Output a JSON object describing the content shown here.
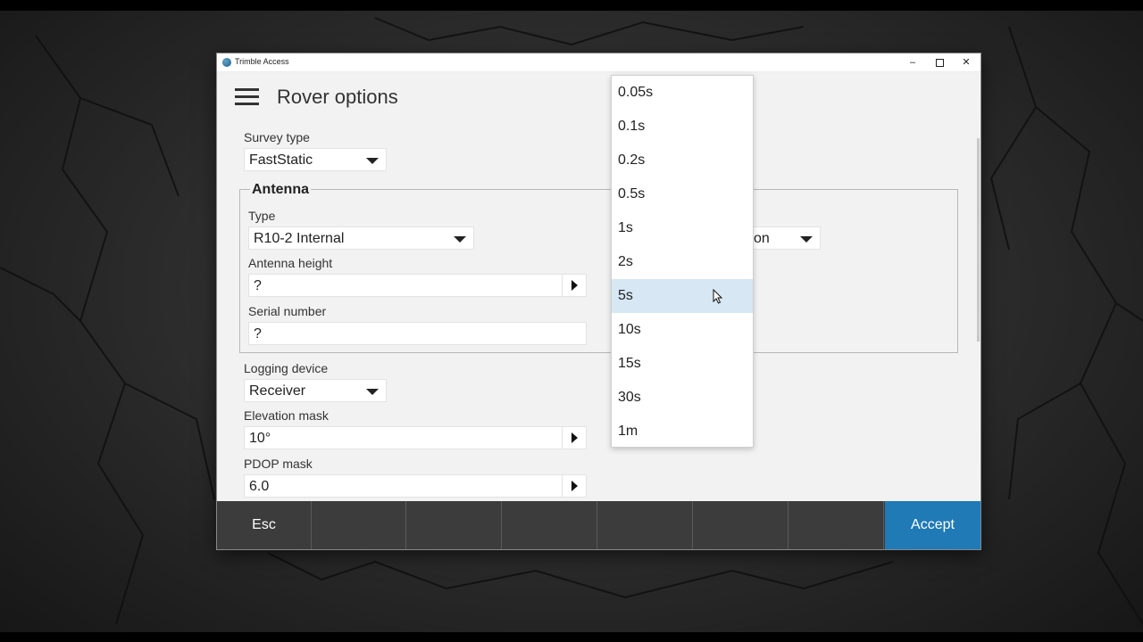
{
  "window": {
    "title": "Trimble Access",
    "controls": [
      "minimize",
      "maximize",
      "close"
    ]
  },
  "page": {
    "title": "Rover options"
  },
  "survey_type": {
    "label": "Survey type",
    "value": "FastStatic"
  },
  "antenna": {
    "group_label": "Antenna",
    "type_label": "Type",
    "type_value": "R10-2 Internal",
    "height_label": "Antenna height",
    "height_value": "?",
    "serial_label": "Serial number",
    "serial_value": "?",
    "partial_select_value": "on"
  },
  "logging_device": {
    "label": "Logging device",
    "value": "Receiver"
  },
  "elevation_mask": {
    "label": "Elevation mask",
    "value": "10°"
  },
  "pdop_mask": {
    "label": "PDOP mask",
    "value": "6.0"
  },
  "interval_dropdown": {
    "options": [
      "0.05s",
      "0.1s",
      "0.2s",
      "0.5s",
      "1s",
      "2s",
      "5s",
      "10s",
      "15s",
      "30s",
      "1m"
    ],
    "highlighted": "5s"
  },
  "footer": {
    "esc_label": "Esc",
    "accept_label": "Accept"
  },
  "colors": {
    "accent": "#1f7ab6",
    "footer": "#3c3c3c",
    "highlight": "#d7e7f4"
  }
}
